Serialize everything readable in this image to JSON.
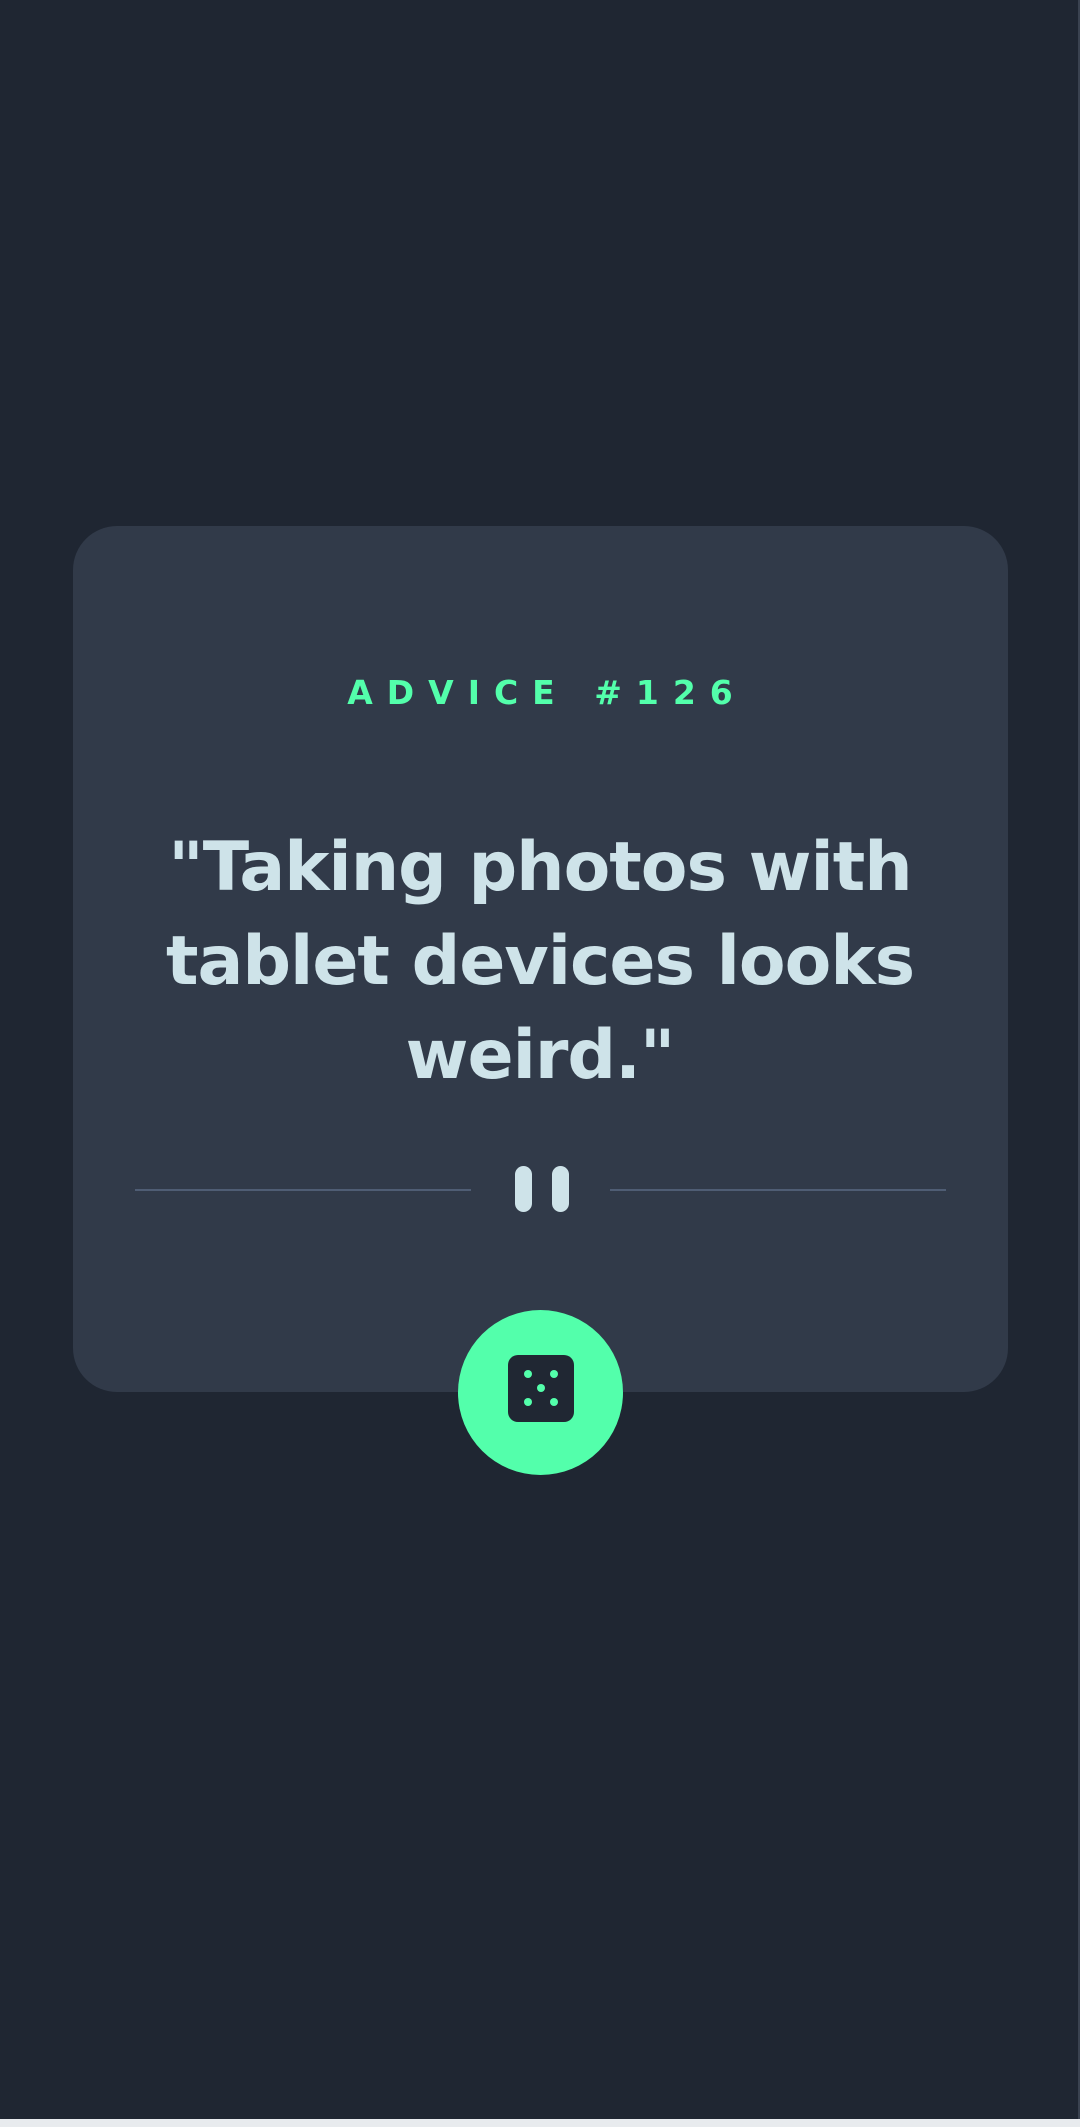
{
  "advice": {
    "label": "ADVICE #126",
    "quote": "\"Taking photos with tablet devices looks weird.\""
  },
  "icons": {
    "divider": "pause-icon",
    "button": "dice-icon"
  },
  "colors": {
    "background": "#1f2632",
    "card": "#313a49",
    "accent": "#53ffab",
    "text": "#cee3e9",
    "divider": "#4f5d74"
  }
}
